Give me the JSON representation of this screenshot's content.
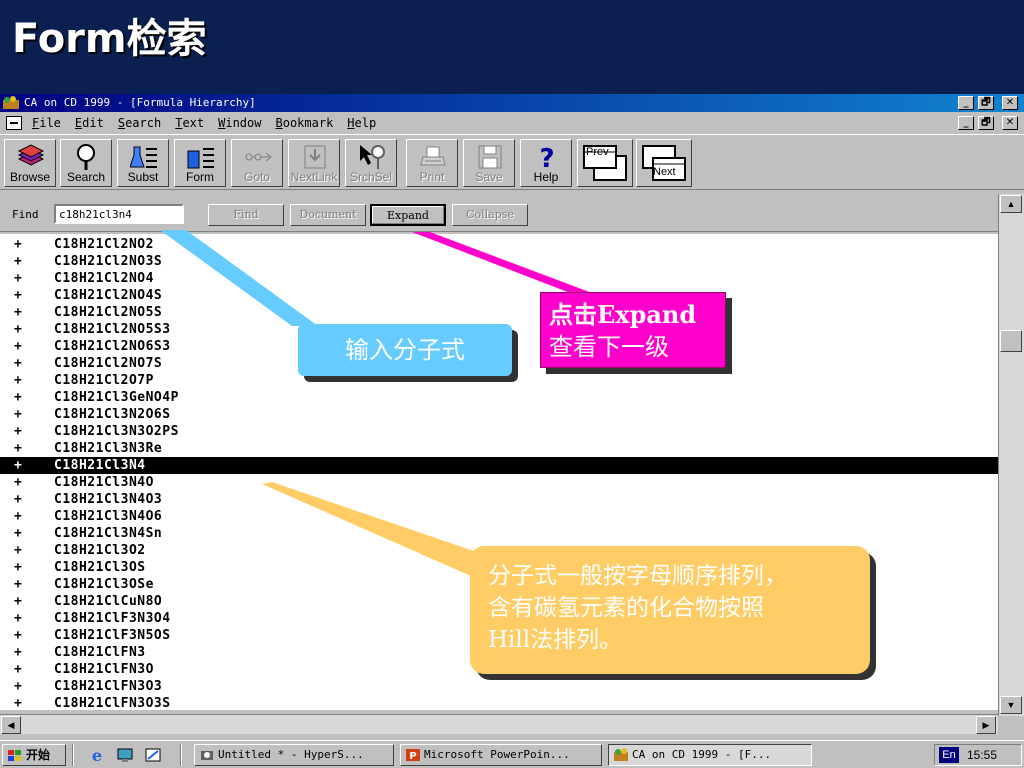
{
  "slide": {
    "title": "Form检索"
  },
  "window": {
    "title": "CA on CD 1999  - [Formula Hierarchy]",
    "controls": [
      "_",
      "🗗",
      "✕"
    ],
    "menu": [
      "File",
      "Edit",
      "Search",
      "Text",
      "Window",
      "Bookmark",
      "Help"
    ]
  },
  "toolbar": {
    "buttons": [
      {
        "label": "Browse",
        "icon": "book-stack-icon",
        "enabled": true
      },
      {
        "label": "Search",
        "icon": "magnifier-icon",
        "enabled": true
      },
      {
        "label": "Subst",
        "icon": "flask-list-icon",
        "enabled": true
      },
      {
        "label": "Form",
        "icon": "beaker-list-icon",
        "enabled": true
      },
      {
        "label": "Goto",
        "icon": "goto-icon",
        "enabled": false
      },
      {
        "label": "NextLink",
        "icon": "nextlink-icon",
        "enabled": false
      },
      {
        "label": "SrchSel",
        "icon": "search-selection-icon",
        "enabled": false
      },
      {
        "label": "Print",
        "icon": "printer-icon",
        "enabled": false
      },
      {
        "label": "Save",
        "icon": "floppy-icon",
        "enabled": false
      },
      {
        "label": "Help",
        "icon": "question-icon",
        "enabled": true
      },
      {
        "label": "Prev",
        "icon": "prev-window-icon",
        "enabled": true
      },
      {
        "label": "Next",
        "icon": "next-window-icon",
        "enabled": true
      }
    ]
  },
  "findbar": {
    "label": "Find",
    "input_value": "c18h21cl3n4",
    "buttons": {
      "find": "Find",
      "document": "Document",
      "expand": "Expand",
      "collapse": "Collapse"
    }
  },
  "list": {
    "selected_index": 13,
    "rows": [
      {
        "marker": "+",
        "formula": "C18H21Cl2NO2"
      },
      {
        "marker": "+",
        "formula": "C18H21Cl2NO3S"
      },
      {
        "marker": "+",
        "formula": "C18H21Cl2NO4"
      },
      {
        "marker": "+",
        "formula": "C18H21Cl2NO4S"
      },
      {
        "marker": "+",
        "formula": "C18H21Cl2NO5S"
      },
      {
        "marker": "+",
        "formula": "C18H21Cl2NO5S3"
      },
      {
        "marker": "+",
        "formula": "C18H21Cl2NO6S3"
      },
      {
        "marker": "+",
        "formula": "C18H21Cl2NO7S"
      },
      {
        "marker": "+",
        "formula": "C18H21Cl2O7P"
      },
      {
        "marker": "+",
        "formula": "C18H21Cl3GeNO4P"
      },
      {
        "marker": "+",
        "formula": "C18H21Cl3N2O6S"
      },
      {
        "marker": "+",
        "formula": "C18H21Cl3N3O2PS"
      },
      {
        "marker": "+",
        "formula": "C18H21Cl3N3Re"
      },
      {
        "marker": "+",
        "formula": "C18H21Cl3N4"
      },
      {
        "marker": "+",
        "formula": "C18H21Cl3N4O"
      },
      {
        "marker": "+",
        "formula": "C18H21Cl3N4O3"
      },
      {
        "marker": "+",
        "formula": "C18H21Cl3N4O6"
      },
      {
        "marker": "+",
        "formula": "C18H21Cl3N4Sn"
      },
      {
        "marker": "+",
        "formula": "C18H21Cl3O2"
      },
      {
        "marker": "+",
        "formula": "C18H21Cl3OS"
      },
      {
        "marker": "+",
        "formula": "C18H21Cl3OSe"
      },
      {
        "marker": "+",
        "formula": "C18H21ClCuN8O"
      },
      {
        "marker": "+",
        "formula": "C18H21ClF3N3O4"
      },
      {
        "marker": "+",
        "formula": "C18H21ClF3N5OS"
      },
      {
        "marker": "+",
        "formula": "C18H21ClFN3"
      },
      {
        "marker": "+",
        "formula": "C18H21ClFN3O"
      },
      {
        "marker": "+",
        "formula": "C18H21ClFN3O3"
      },
      {
        "marker": "+",
        "formula": "C18H21ClFN3O3S"
      }
    ]
  },
  "callouts": {
    "input_formula": "输入分子式",
    "expand_line1": "点击Expand",
    "expand_line2": "查看下一级",
    "order_line1": "分子式一般按字母顺序排列，",
    "order_line2": "含有碳氢元素的化合物按照",
    "order_line3": "Hill法排列。"
  },
  "taskbar": {
    "start": "开始",
    "tasks": [
      "Untitled * - HyperS...",
      "Microsoft PowerPoin...",
      "CA on CD 1999  - [F..."
    ],
    "language": "En",
    "clock": "15:55"
  },
  "colors": {
    "slide_background": "#0a2050",
    "titlebar": "#000080",
    "callout_cyan": "#66ccff",
    "callout_magenta": "#ff00cc",
    "callout_yellow": "#ffcc66"
  }
}
